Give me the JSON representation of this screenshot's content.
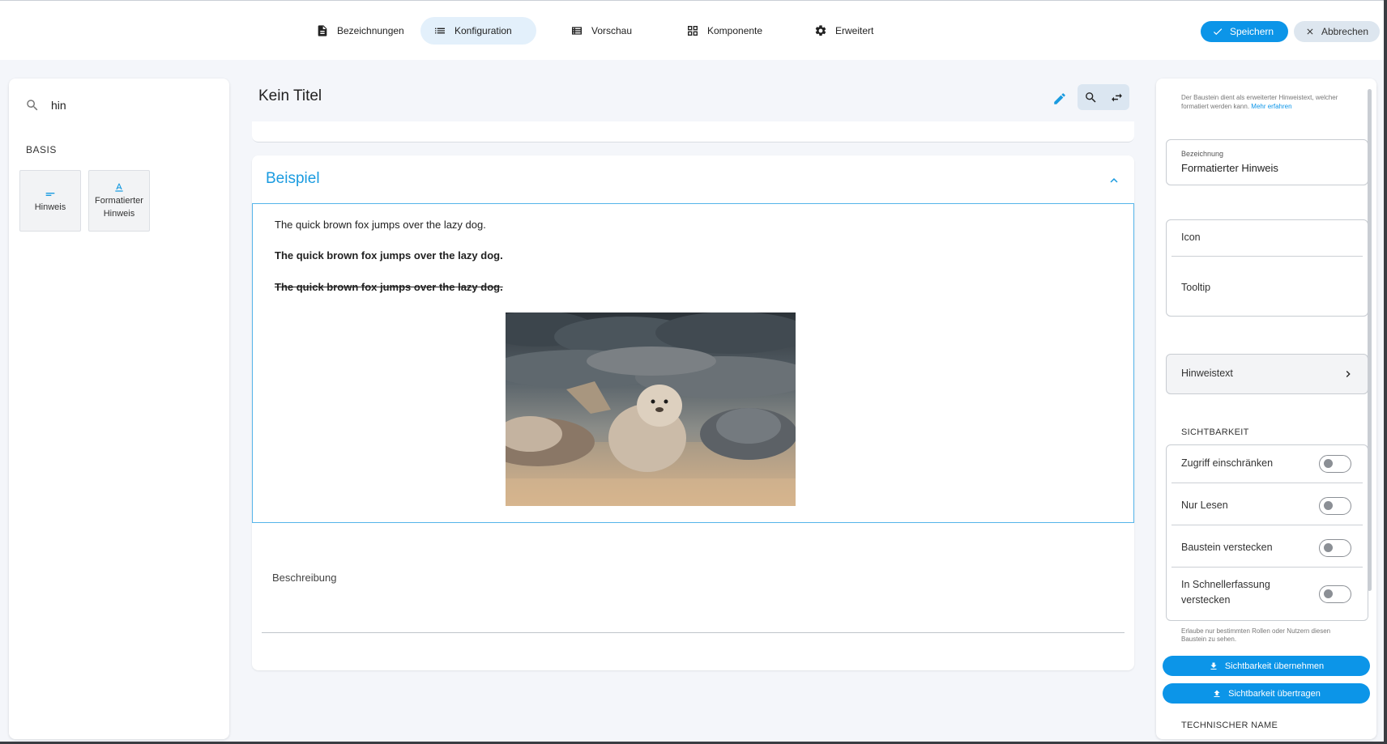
{
  "topbar": {
    "tabs": [
      {
        "label": "Bezeichnungen",
        "icon": "document-icon",
        "active": false
      },
      {
        "label": "Konfiguration",
        "icon": "list-icon",
        "active": true
      },
      {
        "label": "Vorschau",
        "icon": "table-list-icon",
        "active": false
      },
      {
        "label": "Komponente",
        "icon": "grid-icon",
        "active": false
      },
      {
        "label": "Erweitert",
        "icon": "gear-icon",
        "active": false
      }
    ],
    "save_label": "Speichern",
    "cancel_label": "Abbrechen"
  },
  "left": {
    "search_value": "hin",
    "section_label": "BASIS",
    "blocks": [
      {
        "label": "Hinweis",
        "icon": "short-text-icon"
      },
      {
        "label": "Formatierter Hinweis",
        "icon": "text-format-icon"
      }
    ]
  },
  "center": {
    "title": "Kein Titel",
    "example_title": "Beispiel",
    "lines": [
      "The quick brown fox jumps over the lazy dog.",
      "The quick brown fox jumps over the lazy dog.",
      "The quick brown fox jumps over the lazy dog."
    ],
    "description_label": "Beschreibung"
  },
  "right": {
    "hint_text": "Der Baustein dient als erweiterter Hinweistext, welcher formatiert werden kann.",
    "hint_link": "Mehr erfahren",
    "bezeichnung_label": "Bezeichnung",
    "bezeichnung_value": "Formatierter Hinweis",
    "icon_label": "Icon",
    "tooltip_label": "Tooltip",
    "hinweistext_label": "Hinweistext",
    "visibility_label": "SICHTBARKEIT",
    "toggles": [
      {
        "label": "Zugriff einschränken",
        "on": false
      },
      {
        "label": "Nur Lesen",
        "on": false
      },
      {
        "label": "Baustein verstecken",
        "on": false
      },
      {
        "label": "In Schnellerfassung verstecken",
        "on": false
      }
    ],
    "visibility_note": "Erlaube nur bestimmten Rollen oder Nutzern diesen Baustein zu sehen.",
    "btn_apply": "Sichtbarkeit übernehmen",
    "btn_transfer": "Sichtbarkeit übertragen",
    "technical_label": "TECHNISCHER NAME"
  },
  "colors": {
    "accent": "#0c95e8",
    "active_tab_bg": "#e3f0fb",
    "title_blue": "#1a9be0"
  }
}
